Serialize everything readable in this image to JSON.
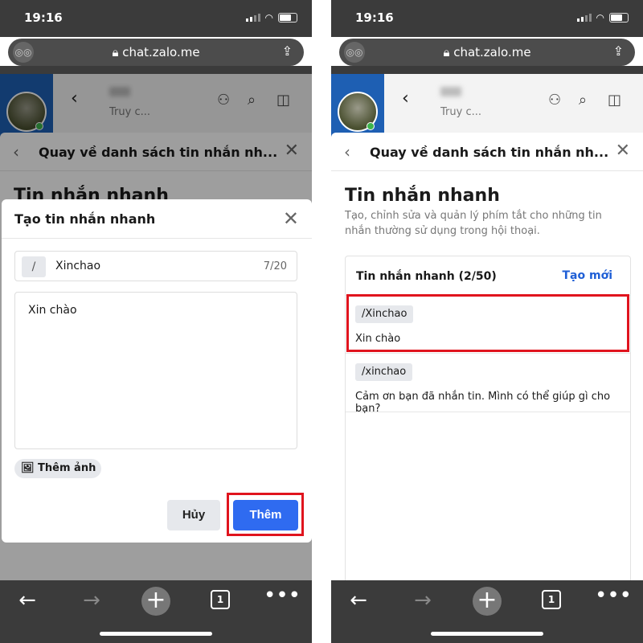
{
  "status": {
    "time": "19:16"
  },
  "browser": {
    "url": "chat.zalo.me",
    "tab_count": "1"
  },
  "chat_header": {
    "subtitle": "Truy c..."
  },
  "panel": {
    "back_title": "Quay về danh sách tin nhắn nh...",
    "title": "Tin nhắn nhanh",
    "description": "Tạo, chỉnh sửa và quản lý phím tắt cho những tin nhắn thường sử dụng trong hội thoại."
  },
  "modal": {
    "title": "Tạo tin nhắn nhanh",
    "prefix": "/",
    "shortcut_value": "Xinchao",
    "char_count": "7/20",
    "message_value": "Xin chào",
    "add_image_label": "Thêm ảnh",
    "cancel_label": "Hủy",
    "submit_label": "Thêm"
  },
  "list": {
    "header": "Tin nhắn nhanh (2/50)",
    "create_label": "Tạo mới",
    "items": [
      {
        "shortcut": "/Xinchao",
        "message": "Xin chào"
      },
      {
        "shortcut": "/xinchao",
        "message": "Cảm ơn bạn đã nhắn tin. Mình có thể giúp gì cho bạn?"
      }
    ]
  },
  "colors": {
    "primary": "#2f6bf0",
    "highlight": "#e0141e",
    "sidebar": "#1e5fb3"
  }
}
